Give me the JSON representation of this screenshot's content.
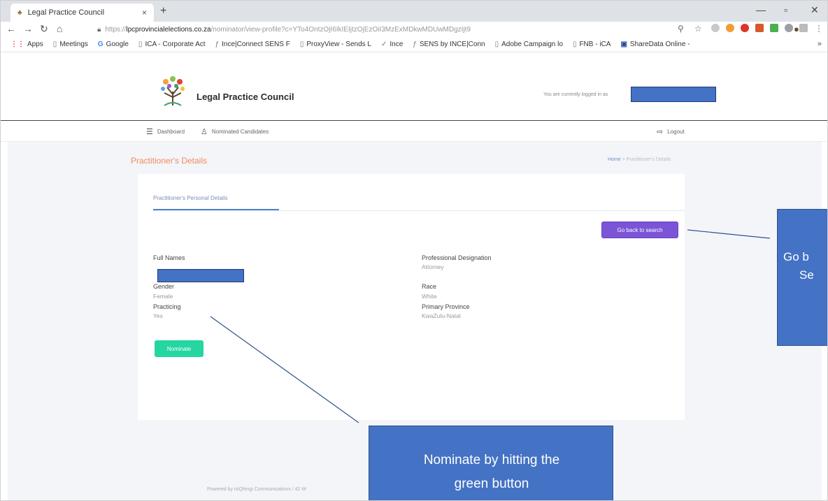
{
  "browser": {
    "tab_title": "Legal Practice Council",
    "tab_close": "×",
    "new_tab": "+",
    "url_prefix": "https://",
    "url_host": "lpcprovincialelections.co.za",
    "url_path": "/nominator/view-profile?c=YTo4OntzOjI6IkIEIjtzOjEzOiI3MzExMDkwMDUwMDgzIjt9",
    "bookmarks": [
      {
        "label": "Apps",
        "icon": "apps-grid-icon"
      },
      {
        "label": "Meetings",
        "icon": "page-icon"
      },
      {
        "label": "Google",
        "icon": "google-icon"
      },
      {
        "label": "ICA - Corporate Act",
        "icon": "page-icon"
      },
      {
        "label": "Ince|Connect SENS F",
        "icon": "ince-icon"
      },
      {
        "label": "ProxyView - Sends L",
        "icon": "page-icon"
      },
      {
        "label": "Ince",
        "icon": "check-icon"
      },
      {
        "label": "SENS by INCE|Conn",
        "icon": "ince-icon"
      },
      {
        "label": "Adobe Campaign lo",
        "icon": "page-icon"
      },
      {
        "label": "FNB - iCA",
        "icon": "page-icon"
      },
      {
        "label": "ShareData Online -",
        "icon": "sharedata-icon"
      }
    ],
    "bookmarks_more": "»"
  },
  "header": {
    "brand": "Legal Practice Council",
    "logged_in_text": "You are currently logged in as"
  },
  "nav": {
    "dashboard": "Dashboard",
    "nominated": "Nominated Candidates",
    "logout": "Logout"
  },
  "page": {
    "title": "Practitioner's Details",
    "breadcrumb_home": "Home",
    "breadcrumb_sep": " > ",
    "breadcrumb_current": "Practitioner's Details"
  },
  "card": {
    "tab_label": "Practitioner's Personal Details",
    "back_button": "Go back to search",
    "fields": {
      "full_names_label": "Full Names",
      "designation_label": "Professional Designation",
      "designation_value": "Attorney",
      "gender_label": "Gender",
      "gender_value": "Female",
      "race_label": "Race",
      "race_value": "White",
      "practicing_label": "Practicing",
      "practicing_value": "Yes",
      "province_label": "Primary Province",
      "province_value": "KwaZulu-Natal"
    },
    "nominate_button": "Nominate"
  },
  "footer": {
    "text": "Powered by isiQhingi Communications / 42 W"
  },
  "callouts": {
    "right_line1": "Go b",
    "right_line2": "Se",
    "bottom_line1": "Nominate by hitting the",
    "bottom_line2": "green button"
  },
  "colors": {
    "accent_purple": "#7b55d6",
    "accent_green": "#25d6a0",
    "title_orange": "#f08c5c",
    "callout_blue": "#4472c4"
  }
}
